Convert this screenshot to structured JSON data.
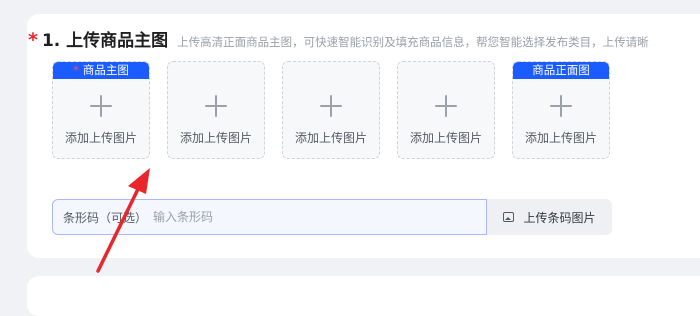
{
  "section": {
    "required_mark": "*",
    "title": "1. 上传商品主图",
    "subtitle": "上传高清正面商品主图，可快速智能识别及填充商品信息，帮您智能选择发布类目，上传请晰"
  },
  "tiles": [
    {
      "badge_star": "*",
      "badge": "商品主图",
      "label": "添加上传图片"
    },
    {
      "badge_star": "",
      "badge": "",
      "label": "添加上传图片"
    },
    {
      "badge_star": "",
      "badge": "",
      "label": "添加上传图片"
    },
    {
      "badge_star": "",
      "badge": "",
      "label": "添加上传图片"
    },
    {
      "badge_star": "",
      "badge": "商品正面图",
      "label": "添加上传图片"
    }
  ],
  "barcode": {
    "label": "条形码（可选）",
    "placeholder": "输入条形码",
    "value": ""
  },
  "upload_barcode_button": {
    "icon": "image-icon",
    "label": "上传条码图片"
  },
  "colors": {
    "accent": "#1a5cff",
    "required": "#f5222d",
    "annotation_arrow": "#e8262b"
  }
}
